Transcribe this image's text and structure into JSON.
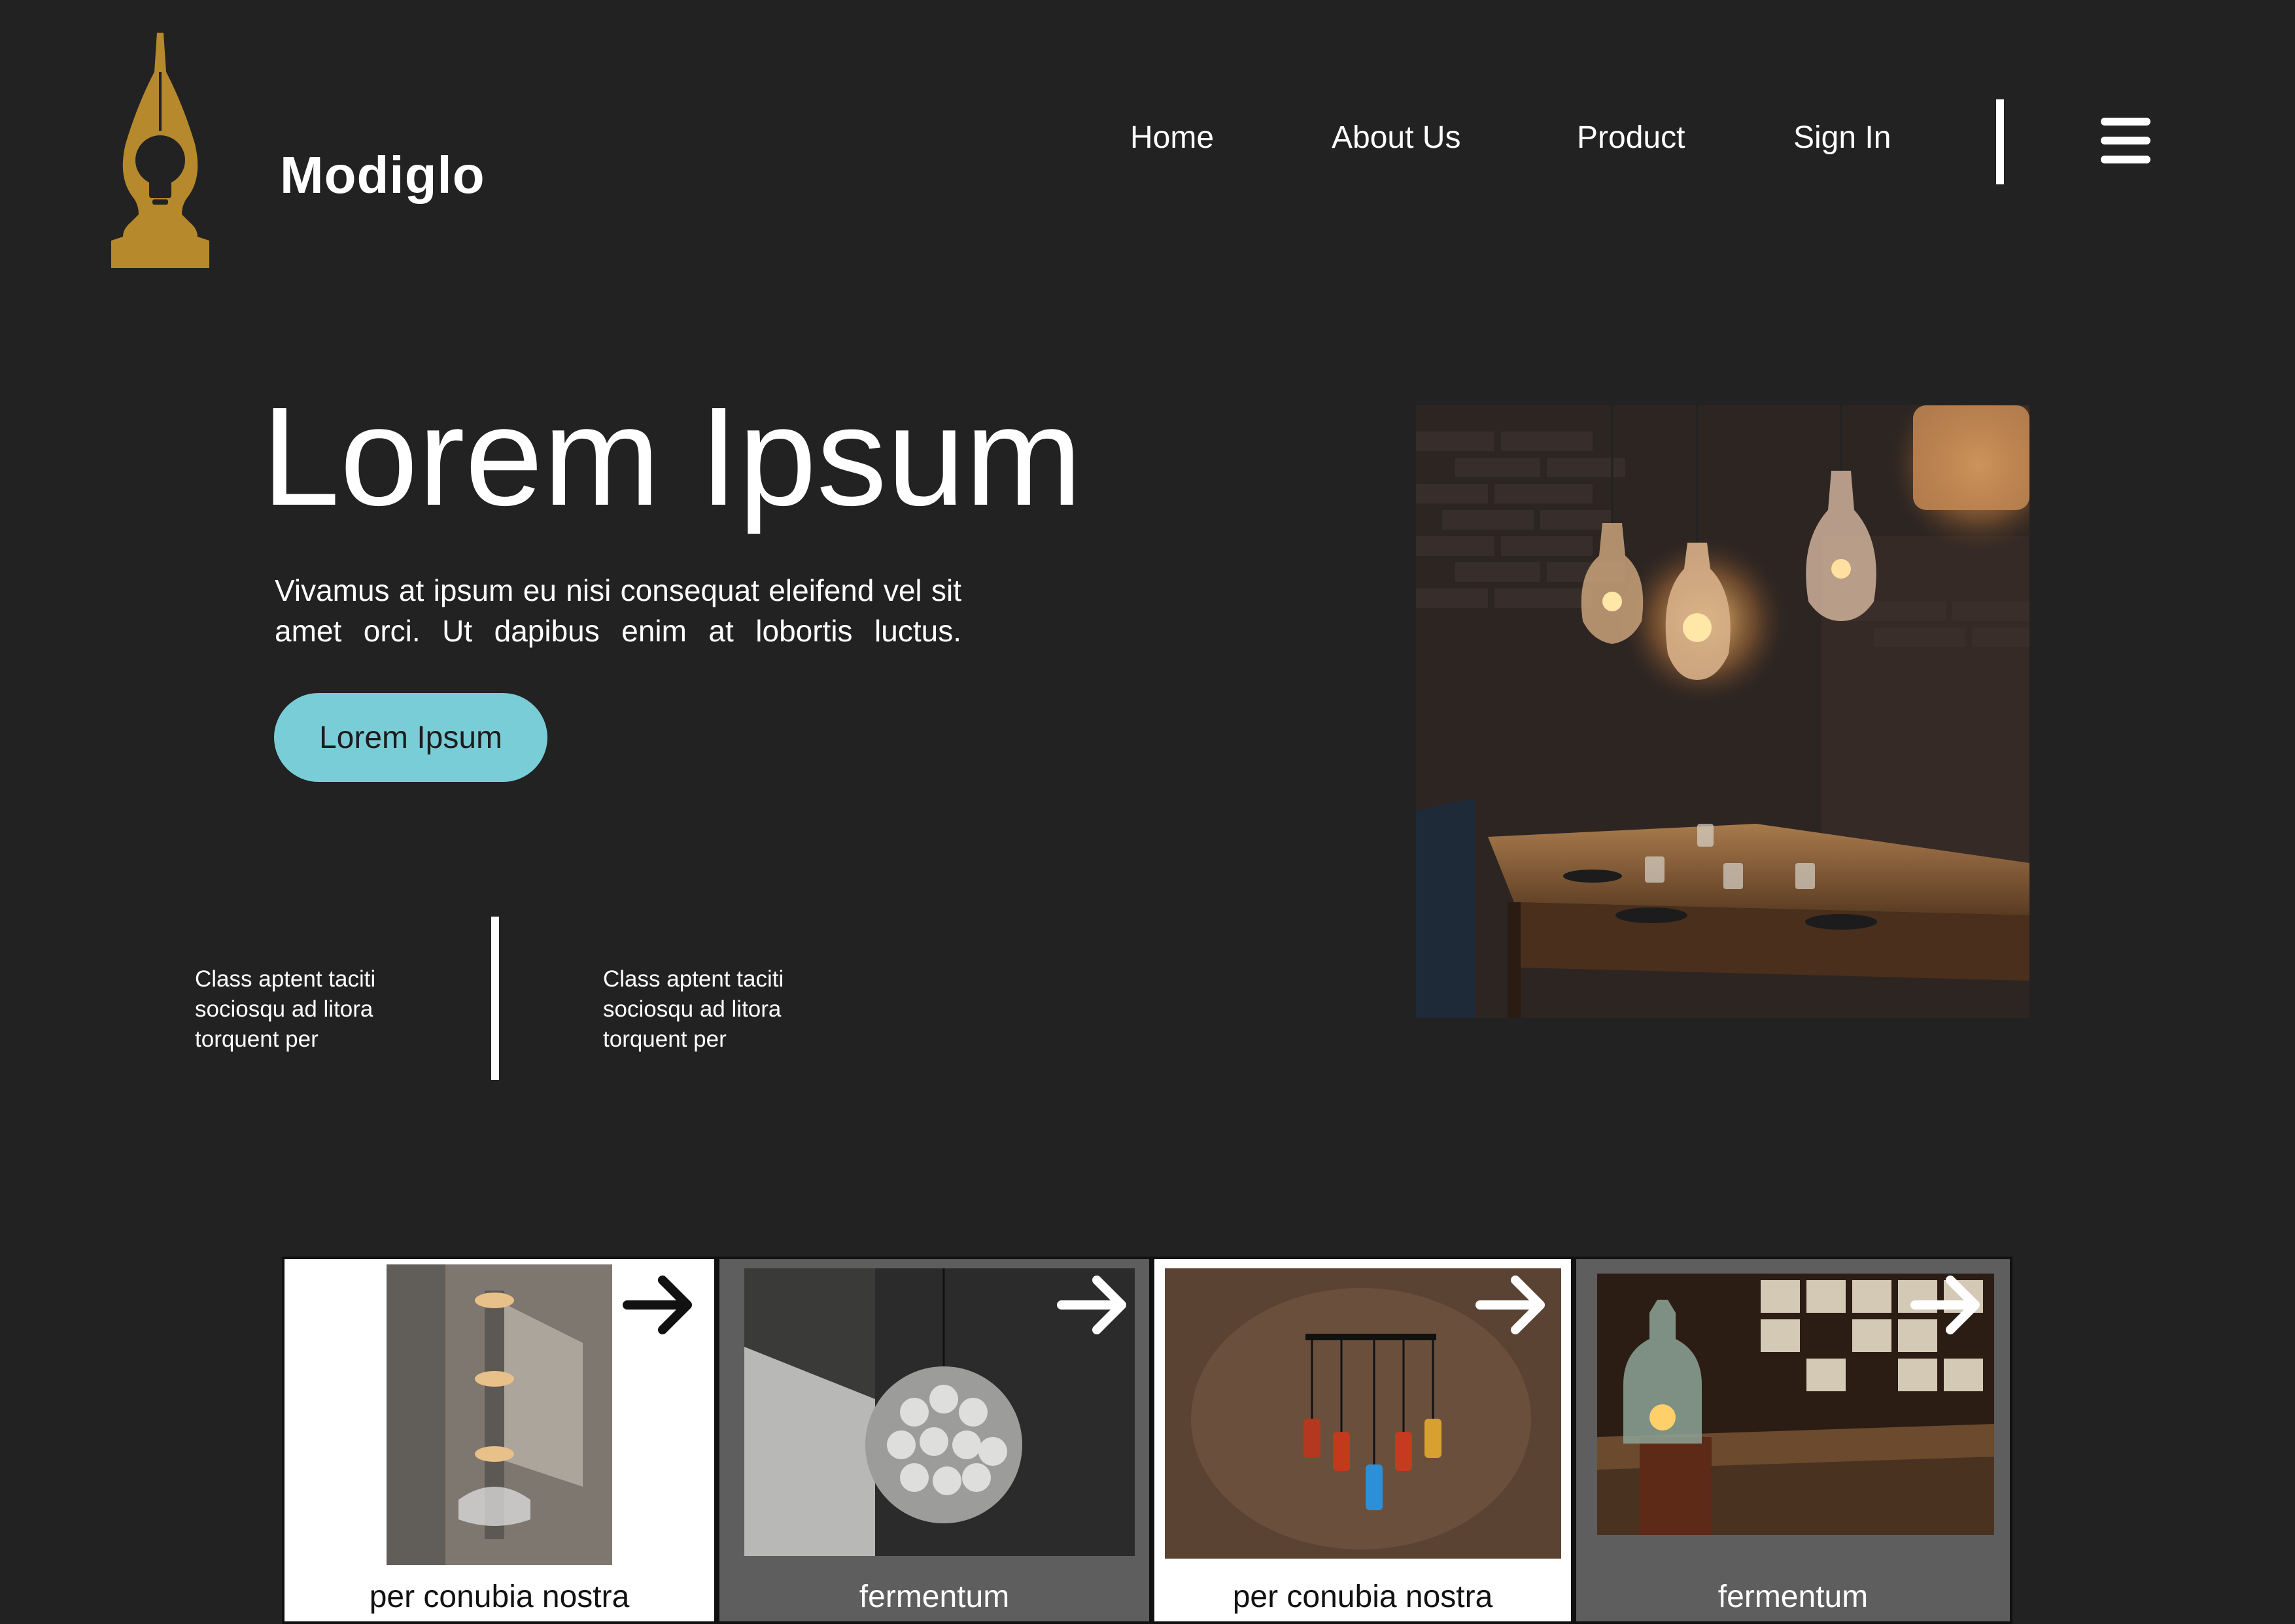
{
  "brand": {
    "name": "Modiglo",
    "logo_icon": "pen-nib-bulb-icon",
    "logo_color": "#b5892c"
  },
  "nav": {
    "items": [
      {
        "label": "Home"
      },
      {
        "label": "About Us"
      },
      {
        "label": "Product"
      },
      {
        "label": "Sign In"
      }
    ],
    "menu_icon": "hamburger-menu-icon"
  },
  "hero": {
    "title": "Lorem Ipsum",
    "description": "Vivamus at ipsum eu nisi consequat eleifend vel sit amet orci. Ut dapibus enim at lobortis luctus.",
    "cta_label": "Lorem Ipsum",
    "cta_color": "#79cdd6",
    "stats": [
      {
        "text": "Class aptent taciti sociosqu ad litora torquent per"
      },
      {
        "text": "Class aptent taciti sociosqu ad litora torquent per"
      }
    ]
  },
  "cards": [
    {
      "caption": "per conubia nostra",
      "theme": "light",
      "arrow_icon": "arrow-right-icon"
    },
    {
      "caption": "fermentum",
      "theme": "dark",
      "arrow_icon": "arrow-right-icon"
    },
    {
      "caption": "per conubia nostra",
      "theme": "light",
      "arrow_icon": "arrow-right-icon"
    },
    {
      "caption": "fermentum",
      "theme": "dark",
      "arrow_icon": "arrow-right-icon"
    }
  ],
  "colors": {
    "background": "#222222",
    "text": "#ffffff",
    "card_dark": "#5e5e5e",
    "card_light": "#ffffff"
  }
}
